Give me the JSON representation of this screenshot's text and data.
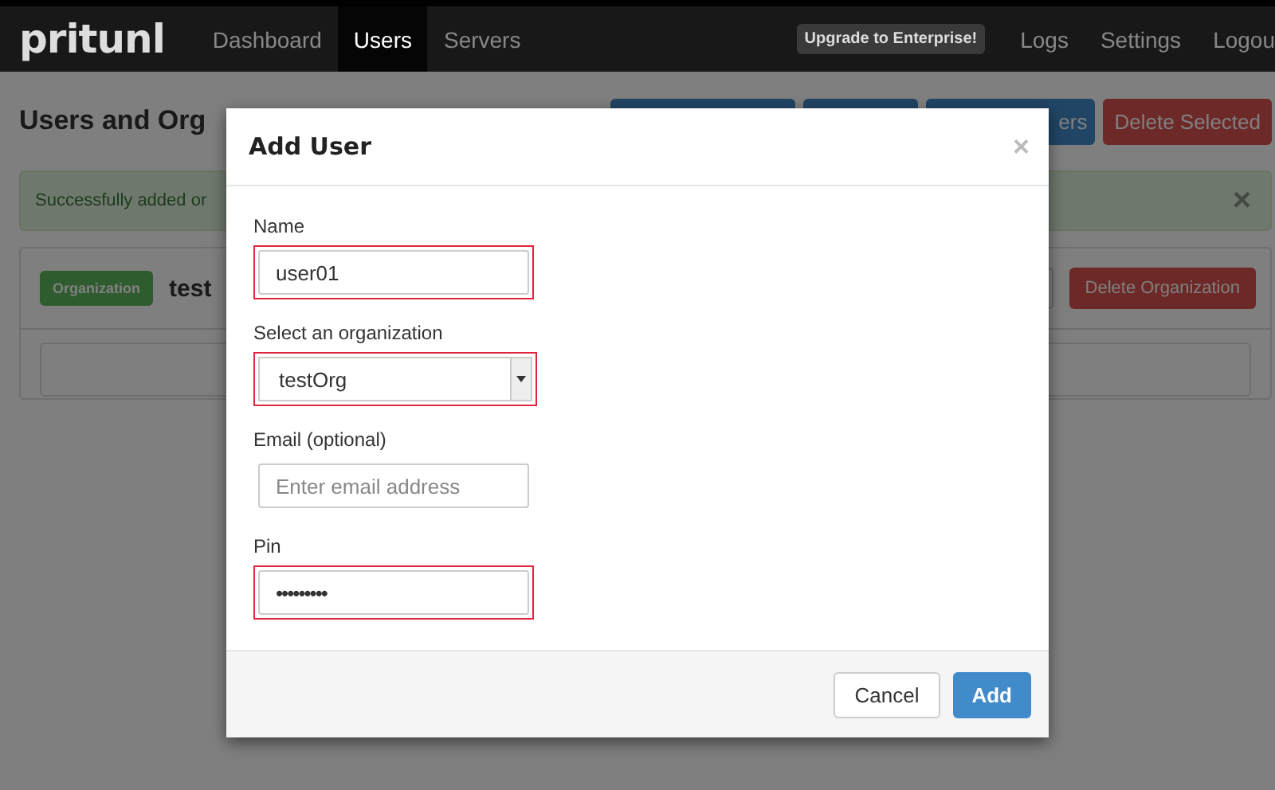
{
  "navbar": {
    "logo": "pritunl",
    "links": [
      {
        "label": "Dashboard",
        "selected": false
      },
      {
        "label": "Users",
        "selected": true
      },
      {
        "label": "Servers",
        "selected": false
      }
    ],
    "upgrade": "Upgrade to Enterprise!",
    "right_links": [
      "Logs",
      "Settings",
      "Logou"
    ]
  },
  "page": {
    "title": "Users and Org",
    "toolbar": [
      {
        "kind": "primary"
      },
      {
        "kind": "primary"
      },
      {
        "label": "ers",
        "kind": "primary"
      },
      {
        "label": "Delete Selected",
        "kind": "danger"
      }
    ],
    "alert": {
      "text": "Successfully added or",
      "close": "×"
    },
    "organization": {
      "badge": "Organization",
      "name": "test",
      "delete": "Delete Organization"
    }
  },
  "modal": {
    "title": "Add User",
    "close": "×",
    "fields": [
      {
        "kind": "text",
        "label": "Name",
        "value": "user01",
        "highlighted": true
      },
      {
        "kind": "select",
        "label": "Select an organization",
        "value": "testOrg",
        "highlighted": true
      },
      {
        "kind": "text",
        "label": "Email (optional)",
        "placeholder": "Enter email address",
        "highlighted": false
      },
      {
        "kind": "password",
        "label": "Pin",
        "value": "•••••••••",
        "highlighted": true
      }
    ],
    "buttons": [
      {
        "label": "Cancel",
        "kind": "default"
      },
      {
        "label": "Add",
        "kind": "primary"
      }
    ]
  }
}
